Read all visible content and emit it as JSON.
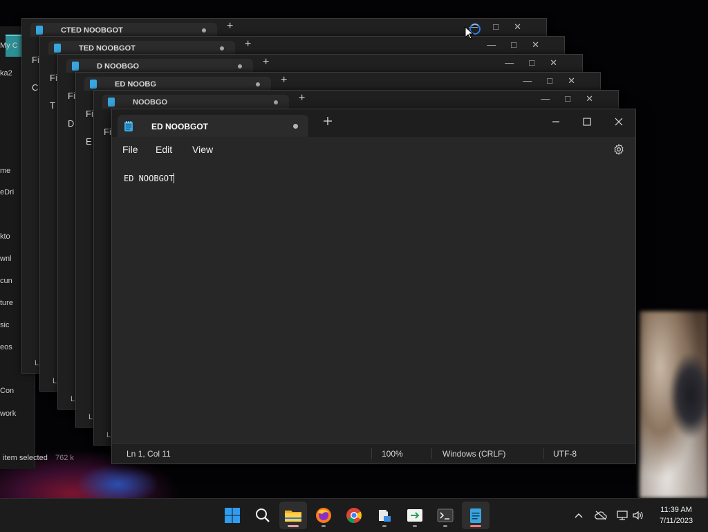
{
  "explorer": {
    "labels": [
      "My C",
      "ka2",
      "me",
      "eDri",
      "kto",
      "wnl",
      "cun",
      "ture",
      "sic",
      "eos",
      "Con",
      "work"
    ],
    "status": "item selected",
    "size": "762 k"
  },
  "stacked_windows": [
    {
      "title": "CTED NOOBGOT",
      "side": "C"
    },
    {
      "title": "TED NOOBGOT",
      "side": "T"
    },
    {
      "title": "D NOOBGO",
      "side": "D"
    },
    {
      "title": "ED NOOBG",
      "side": "E"
    },
    {
      "title": "NOOBGO",
      "side": "Fi"
    }
  ],
  "stack_menu_label": "Fi",
  "stack_status_label": "L",
  "notepad": {
    "tab_title": "ED NOOBGOT",
    "menu": [
      "File",
      "Edit",
      "View"
    ],
    "content": "ED NOOBGOT",
    "status": {
      "position": "Ln 1, Col 11",
      "zoom": "100%",
      "line_ending": "Windows (CRLF)",
      "encoding": "UTF-8"
    }
  },
  "taskbar": {
    "apps": [
      "start-icon",
      "search-icon",
      "file-explorer-icon",
      "firefox-icon",
      "chrome-icon",
      "files-icon",
      "remote-icon",
      "terminal-icon",
      "notepad-icon"
    ],
    "time": "11:39 AM",
    "date": "7/11/2023"
  },
  "colors": {
    "accent": "#38a6e0",
    "taskbar": "#1c1c1c",
    "editor_bg": "#272727",
    "active_indicator": "#f07b7b"
  }
}
